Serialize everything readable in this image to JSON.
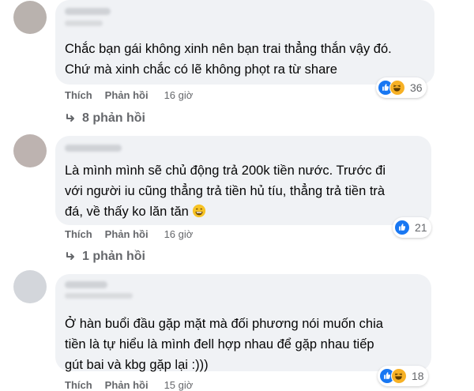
{
  "comments": [
    {
      "lines": [
        "Chắc bạn gái không xinh nên bạn trai thẳng thắn vậy đó.",
        "Chứ mà xinh chắc có lẽ không phọt ra từ share"
      ],
      "reaction_count": "36",
      "reactions": [
        "like-icon",
        "haha-icon"
      ],
      "like_label": "Thích",
      "reply_label": "Phản hồi",
      "time": "16 giờ",
      "replies_label": "8 phản hồi"
    },
    {
      "lines": [
        "Là mình mình sẽ chủ động trả 200k tiền nước. Trước đi",
        "với người iu cũng thẳng trả tiền hủ tíu, thẳng trả tiền trà",
        "đá, về thấy ko lăn tăn"
      ],
      "emoji": "grinning-face-emoji",
      "reaction_count": "21",
      "reactions": [
        "like-icon"
      ],
      "like_label": "Thích",
      "reply_label": "Phản hồi",
      "time": "16 giờ",
      "replies_label": "1 phản hồi"
    },
    {
      "lines": [
        "Ở hàn buổi đầu gặp mặt mà đối phương nói muốn chia",
        "tiền là tự hiểu là mình đell hợp nhau để gặp nhau tiếp",
        "gút bai và kbg gặp lại :)))"
      ],
      "reaction_count": "18",
      "reactions": [
        "like-icon",
        "haha-icon"
      ],
      "like_label": "Thích",
      "reply_label": "Phản hồi",
      "time": "15 giờ"
    }
  ],
  "colors": {
    "bubble": "#f0f2f5",
    "text": "#050505",
    "secondary": "#65676b",
    "like": "#1877f2",
    "haha": "#f7b125"
  }
}
